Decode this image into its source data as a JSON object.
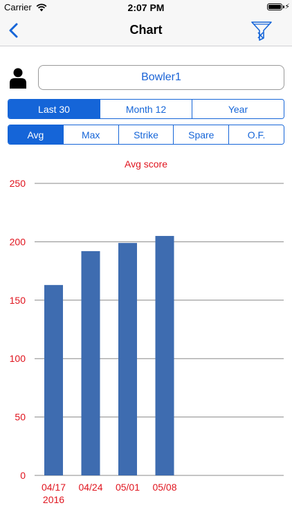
{
  "status_bar": {
    "carrier": "Carrier",
    "time": "2:07 PM"
  },
  "nav": {
    "title": "Chart",
    "back_icon": "chevron-left-icon",
    "filter_icon": "filter-clear-icon"
  },
  "bowler": {
    "icon": "person-icon",
    "name": "Bowler1"
  },
  "period_tabs": {
    "items": [
      "Last 30",
      "Month 12",
      "Year"
    ],
    "selected": "Last 30"
  },
  "metric_tabs": {
    "items": [
      "Avg",
      "Max",
      "Strike",
      "Spare",
      "O.F."
    ],
    "selected": "Avg"
  },
  "colors": {
    "accent": "#1565d8",
    "bar": "#3e6cb0",
    "label_red": "#e0141e",
    "grid": "#888888"
  },
  "chart_data": {
    "type": "bar",
    "title": "Avg score",
    "categories": [
      "04/17",
      "04/24",
      "05/01",
      "05/08"
    ],
    "category_sublabels": [
      "2016",
      "",
      "",
      ""
    ],
    "values": [
      163,
      192,
      199,
      205
    ],
    "ylim": [
      0,
      250
    ],
    "yticks": [
      0,
      50,
      100,
      150,
      200,
      250
    ],
    "grid": true,
    "legend": "none"
  }
}
